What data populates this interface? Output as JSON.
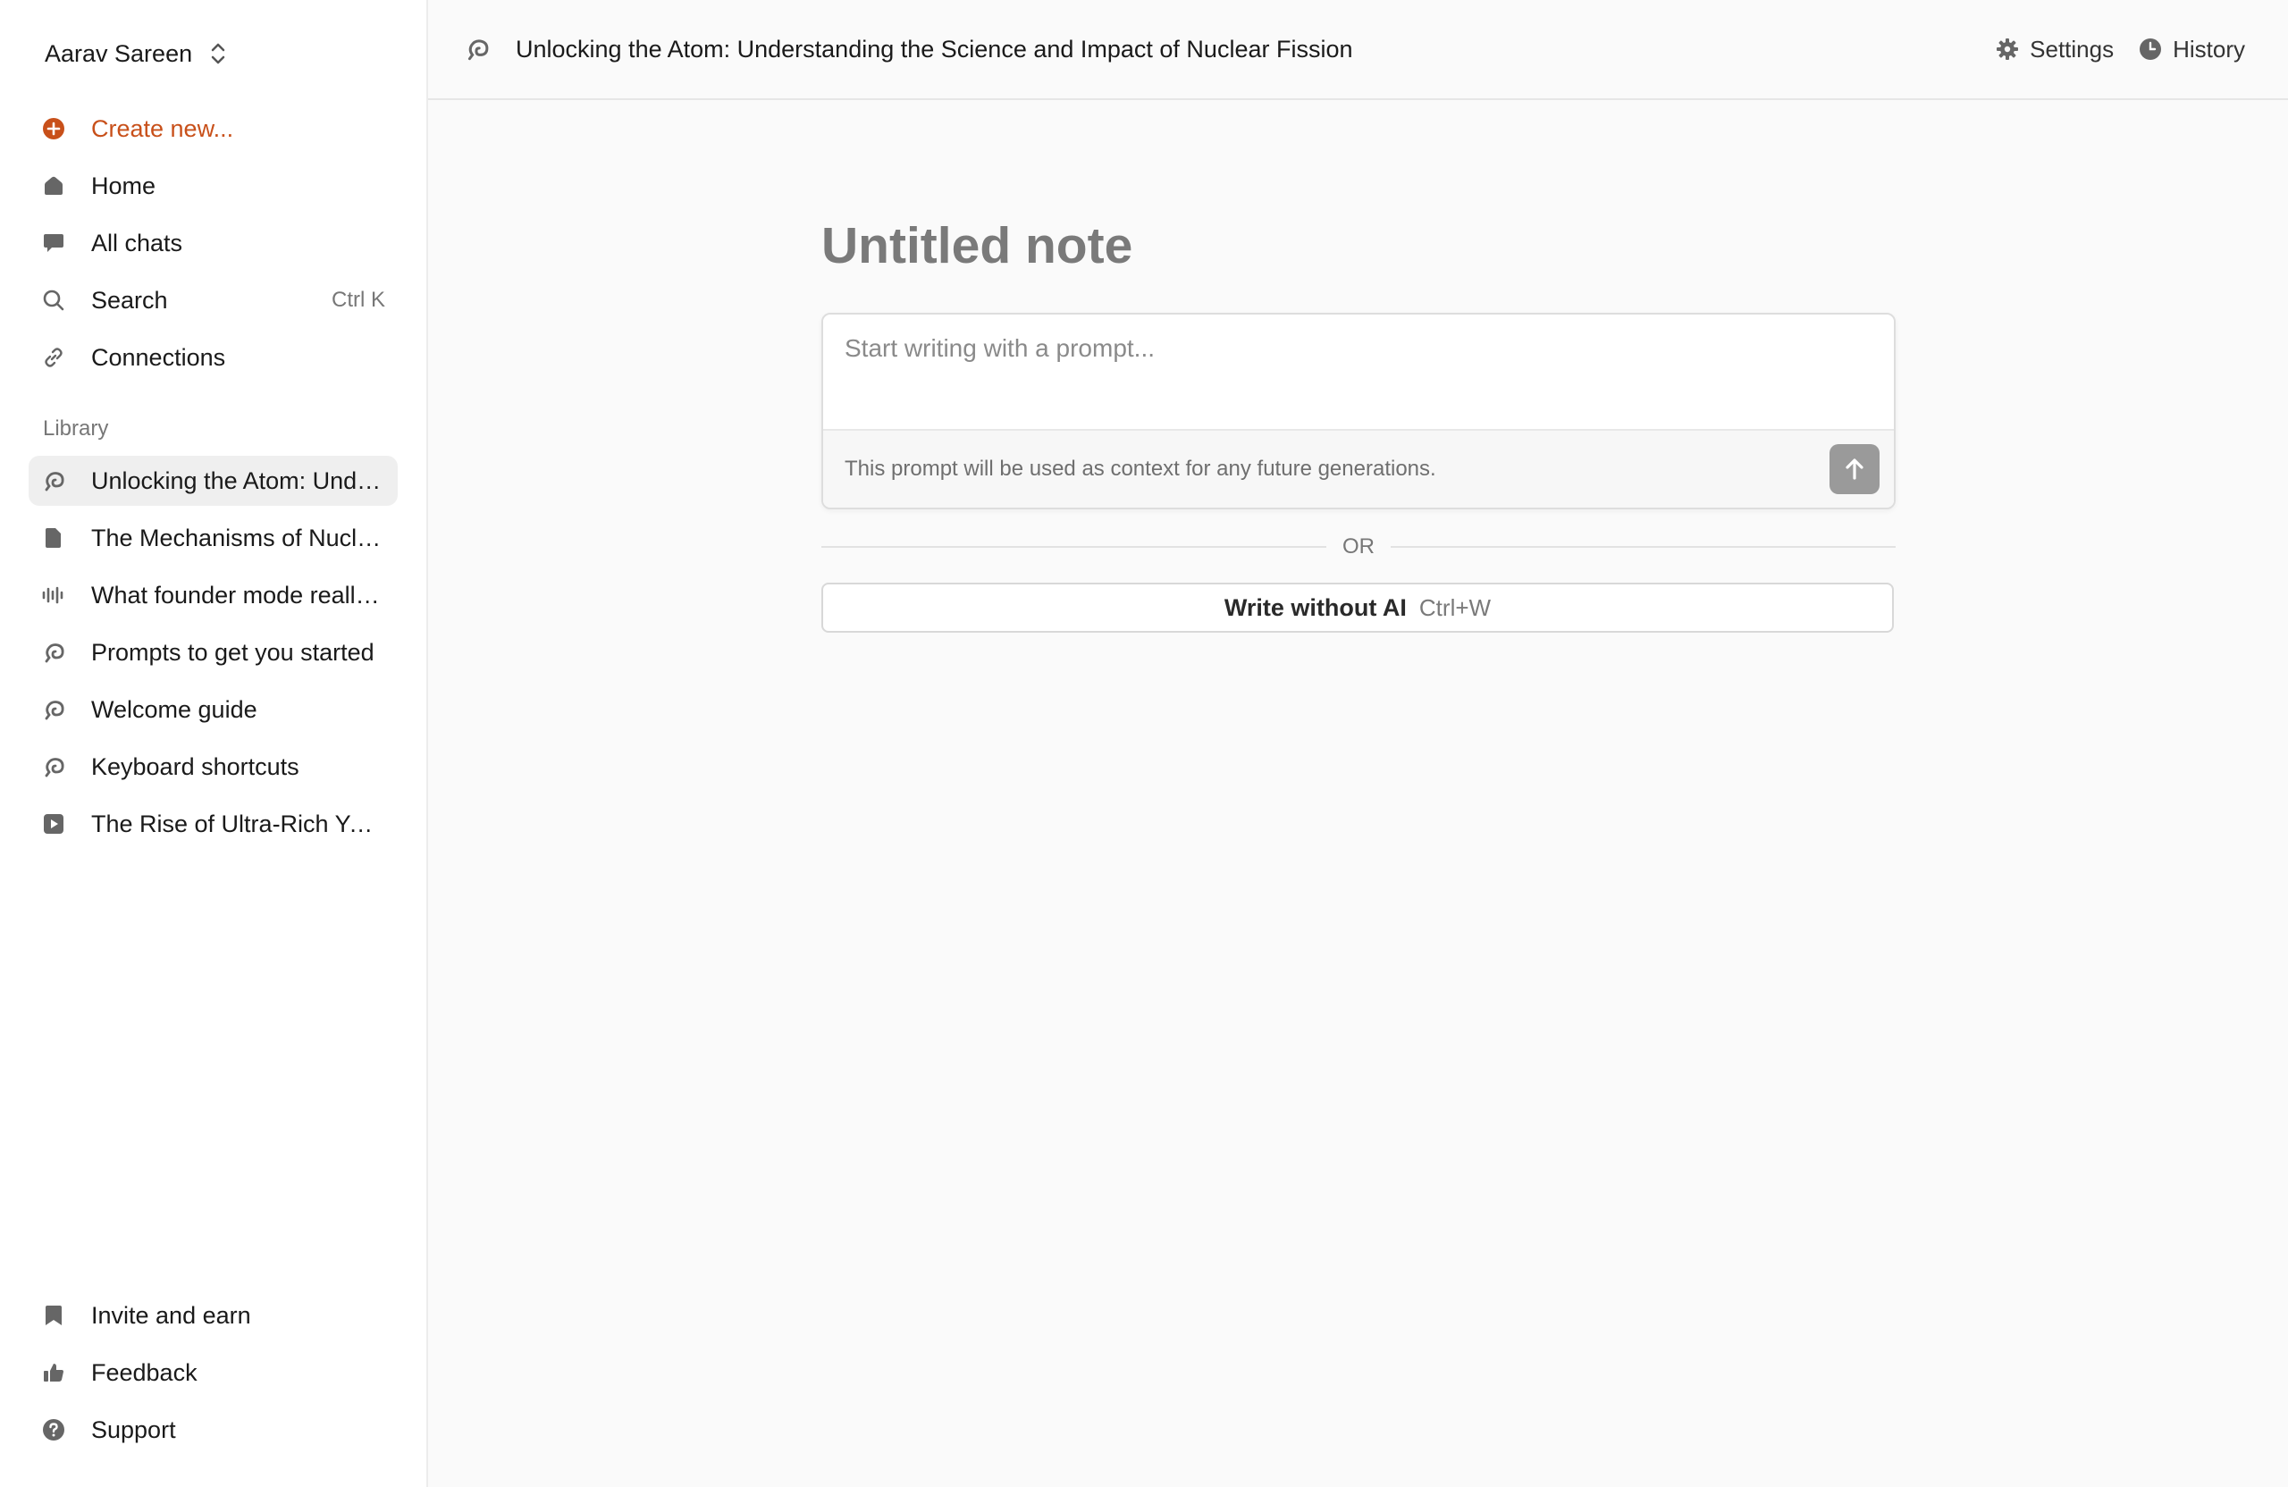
{
  "sidebar": {
    "user_name": "Aarav Sareen",
    "nav": {
      "create": "Create new...",
      "home": "Home",
      "all_chats": "All chats",
      "search": "Search",
      "search_shortcut": "Ctrl K",
      "connections": "Connections"
    },
    "library_label": "Library",
    "library": [
      {
        "label": "Unlocking the Atom: Unde...",
        "icon": "note-swirl-icon",
        "active": true
      },
      {
        "label": "The Mechanisms of Nucle...",
        "icon": "document-icon"
      },
      {
        "label": "What founder mode really...",
        "icon": "audio-waveform-icon"
      },
      {
        "label": "Prompts to get you started",
        "icon": "note-swirl-icon"
      },
      {
        "label": "Welcome guide",
        "icon": "note-swirl-icon"
      },
      {
        "label": "Keyboard shortcuts",
        "icon": "note-swirl-icon"
      },
      {
        "label": "The Rise of Ultra-Rich You...",
        "icon": "video-play-icon"
      }
    ],
    "bottom": {
      "invite": "Invite and earn",
      "feedback": "Feedback",
      "support": "Support"
    }
  },
  "header": {
    "title": "Unlocking the Atom: Understanding the Science and Impact of Nuclear Fission",
    "settings": "Settings",
    "history": "History"
  },
  "editor": {
    "note_title": "Untitled note",
    "prompt_placeholder": "Start writing with a prompt...",
    "prompt_hint": "This prompt will be used as context for any future generations.",
    "or_label": "OR",
    "write_without_ai": "Write without AI",
    "write_shortcut": "Ctrl+W"
  },
  "colors": {
    "accent": "#c8501a",
    "active_item_bg": "#efefef",
    "send_button": "#9a9a9a"
  }
}
